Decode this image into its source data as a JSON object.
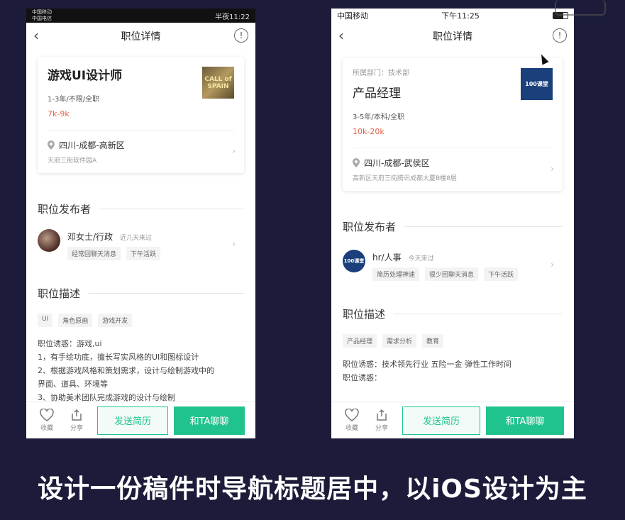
{
  "left": {
    "status": {
      "carrier1": "中国移动",
      "carrier2": "中国电信",
      "time": "半夜11:22"
    },
    "nav": {
      "title": "职位详情",
      "back": "‹",
      "info": "!"
    },
    "job": {
      "title": "游戏UI设计师",
      "meta": "1-3年/不限/全职",
      "salary": "7k-9k",
      "logo_text": "CALL of SPAIN",
      "location": "四川-成都-高新区",
      "address": "天府三街软件园A"
    },
    "publisher_section": "职位发布者",
    "publisher": {
      "name": "邓女士/行政",
      "active": "近几天来过",
      "tags": [
        "经常回聊天消息",
        "下午活跃"
      ]
    },
    "desc_section": "职位描述",
    "desc_tags": [
      "UI",
      "角色原画",
      "游戏开发"
    ],
    "desc_lines": [
      "职位诱惑：游戏,ui",
      "1，有手绘功底，擅长写实风格的UI和图标设计",
      "2、根据游戏风格和策划需求，设计与绘制游戏中的",
      "界面、道具、环境等",
      "3、协助美术团队完成游戏的设计与绘制"
    ],
    "bottom": {
      "fav": "收藏",
      "share": "分享",
      "send": "发送简历",
      "chat": "和TA聊聊"
    }
  },
  "right": {
    "status": {
      "carrier": "中国移动",
      "time": "下午11:25"
    },
    "nav": {
      "title": "职位详情",
      "back": "‹",
      "info": "!"
    },
    "job": {
      "dept": "所属部门：技术部",
      "title": "产品经理",
      "meta": "3-5年/本科/全职",
      "salary": "10k-20k",
      "logo_text": "100课堂",
      "location": "四川-成都-武侯区",
      "address": "高新区天府三街腾讯成都大厦B楼8层"
    },
    "publisher_section": "职位发布者",
    "publisher": {
      "name": "hr/人事",
      "active": "今天来过",
      "tags": [
        "简历处理神速",
        "很少回聊天消息",
        "下午活跃"
      ],
      "avatar_text": "100课堂"
    },
    "desc_section": "职位描述",
    "desc_tags": [
      "产品经理",
      "需求分析",
      "教育"
    ],
    "desc_lines": [
      "职位诱惑：技术领先行业 五险一金 弹性工作时间",
      "职位诱惑："
    ],
    "bottom": {
      "fav": "收藏",
      "share": "分享",
      "send": "发送简历",
      "chat": "和TA聊聊"
    }
  },
  "caption": "设计一份稿件时导航标题居中，以iOS设计为主",
  "colors": {
    "accent": "#20c38e",
    "salary": "#e8604c",
    "background": "#1c1c3a"
  }
}
